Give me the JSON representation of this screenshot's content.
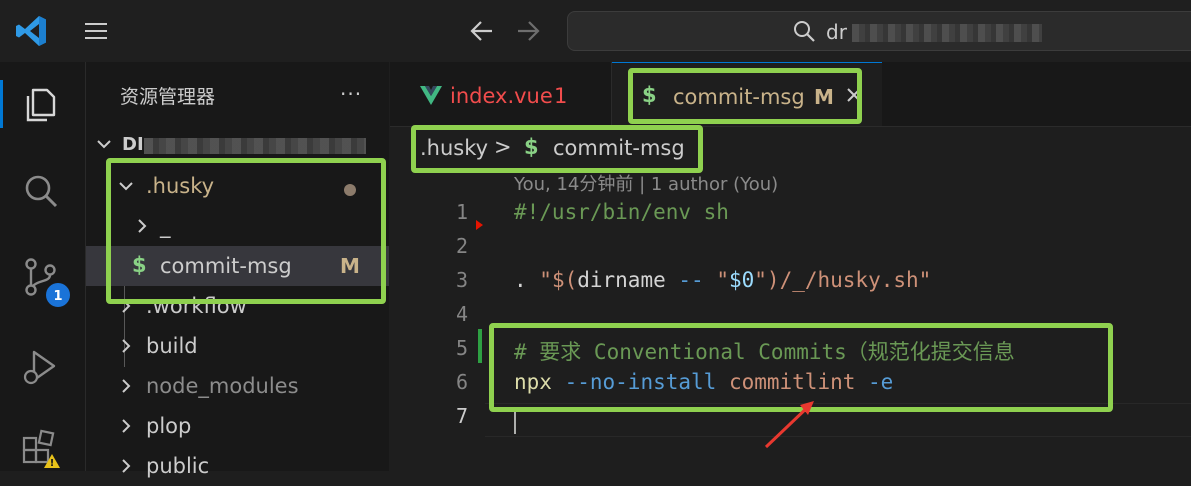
{
  "titlebar": {
    "search_prefix": "dr"
  },
  "sidebar": {
    "title": "资源管理器",
    "more": "···",
    "root_label": "DI",
    "items": [
      {
        "label": ".husky",
        "status": "dot"
      },
      {
        "label": "_"
      },
      {
        "label": "commit-msg",
        "badge": "M",
        "icon": "$"
      },
      {
        "label": ".workflow"
      },
      {
        "label": "build"
      },
      {
        "label": "node_modules"
      },
      {
        "label": "plop"
      },
      {
        "label": "public"
      }
    ]
  },
  "activitybar": {
    "source_control_badge": "1"
  },
  "tabs": [
    {
      "label": "index.vue",
      "problems": "1",
      "icon": "vue-icon",
      "color": "#f14c4c"
    },
    {
      "label": "commit-msg",
      "badge": "M",
      "icon": "$",
      "active": true
    }
  ],
  "breadcrumbs": {
    "folder": ".husky",
    "separator": ">",
    "icon": "$",
    "file": "commit-msg"
  },
  "editor": {
    "blame": "You, 14分钟前 | 1 author (You)",
    "line_numbers": [
      "1",
      "2",
      "3",
      "4",
      "5",
      "6",
      "7"
    ],
    "lines": {
      "l1": "#!/usr/bin/env sh",
      "l3_dot": ". ",
      "l3_q1": "\"$(",
      "l3_cmd": "dirname",
      "l3_dash": " -- ",
      "l3_q2": "\"",
      "l3_var": "$0",
      "l3_q3": "\")/_/husky.sh\"",
      "l5": "# 要求 Conventional Commits（规范化提交信息",
      "l6_cmd": "npx",
      "l6_flag": " --no-install ",
      "l6_arg": "commitlint",
      "l6_e": " -e"
    }
  },
  "colors": {
    "highlight": "#8fd14f",
    "annotation_arrow": "#e8382f",
    "accent": "#0078d4"
  }
}
